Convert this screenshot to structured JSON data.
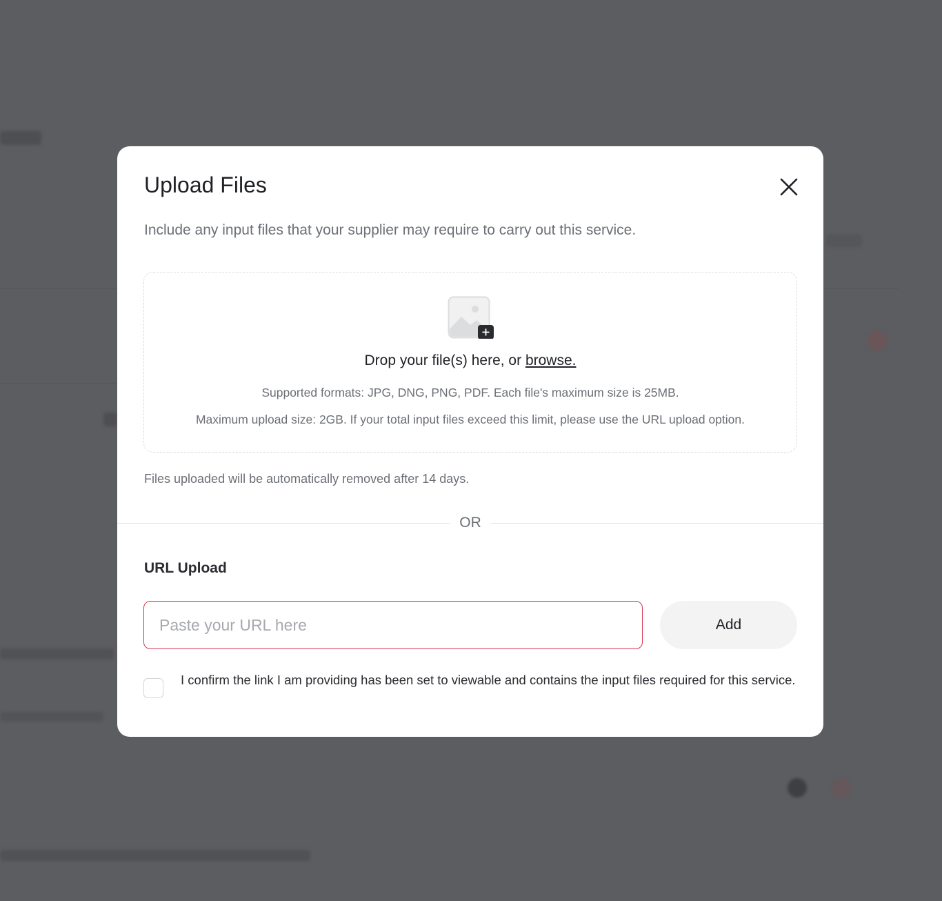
{
  "modal": {
    "title": "Upload Files",
    "subtitle": "Include any input files that your supplier may require to carry out this service.",
    "close_icon": "close-icon",
    "dropzone": {
      "icon": "image-add-icon",
      "drop_text": "Drop your file(s) here, or ",
      "browse_label": "browse.",
      "formats_text": "Supported formats: JPG, DNG, PNG, PDF. Each file's maximum size is 25MB.",
      "max_text": "Maximum upload size: 2GB. If your total input files exceed this limit, please use the URL upload option."
    },
    "removal_note": "Files uploaded will be automatically removed after 14 days.",
    "or_label": "OR",
    "url_upload": {
      "heading": "URL Upload",
      "placeholder": "Paste your URL here",
      "value": "",
      "add_label": "Add",
      "confirm_label": "I confirm the link I am providing has been set to viewable and contains the input files required for this service.",
      "confirm_checked": false
    }
  },
  "colors": {
    "backdrop": "#5c5d61",
    "input_border_error": "#d8344f",
    "add_button_bg": "#f3f3f4",
    "text_primary": "#1f2125",
    "text_secondary": "#6b6f75"
  }
}
